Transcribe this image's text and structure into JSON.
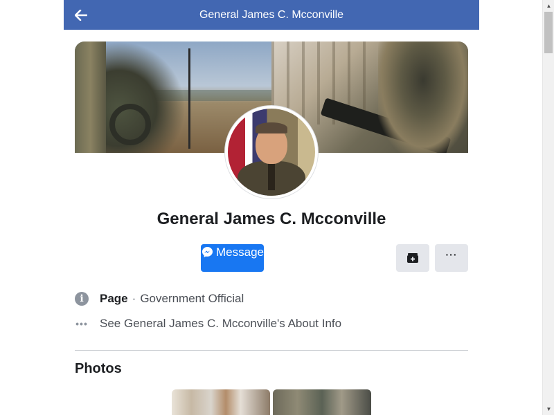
{
  "header": {
    "title": "General James C. Mcconville",
    "back_icon": "arrow-left-icon",
    "background_color": "#4267b2"
  },
  "profile": {
    "name": "General James C. Mcconville",
    "cover_photo": "military-cover-photo",
    "avatar": "profile-picture-general"
  },
  "actions": {
    "message_label": "Message",
    "message_icon": "messenger-icon",
    "message_color": "#1877f2",
    "save_icon": "save-icon",
    "more_label": "···"
  },
  "info": {
    "page_label": "Page",
    "separator": "·",
    "category": "Government Official",
    "about_link": "See General James C. Mcconville's About Info"
  },
  "photos": {
    "title": "Photos"
  }
}
